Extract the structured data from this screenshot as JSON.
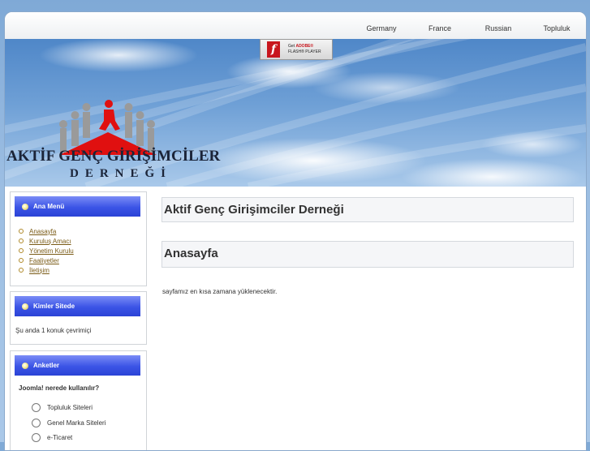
{
  "topnav": {
    "items": [
      {
        "label": "Germany"
      },
      {
        "label": "France"
      },
      {
        "label": "Russian"
      },
      {
        "label": "Topluluk"
      }
    ]
  },
  "header": {
    "flash": {
      "get": "Get",
      "adobe": "ADOBE®",
      "product": "FLASH® PLAYER"
    },
    "logo_title": "AKTİF GENÇ GİRİŞİMCİLER",
    "logo_sub": "DERNEĞİ",
    "colors": {
      "figure_accent": "#e01010",
      "figure_grey": "#9a9a9a"
    }
  },
  "sidebar": {
    "main_menu": {
      "title": "Ana Menü",
      "items": [
        {
          "label": "Anasayfa"
        },
        {
          "label": "Kuruluş Amacı"
        },
        {
          "label": "Yönetim Kurulu"
        },
        {
          "label": "Faaliyetler"
        },
        {
          "label": "İletişim"
        }
      ]
    },
    "who_online": {
      "title": "Kimler Sitede",
      "text": "Şu anda 1 konuk çevrimiçi"
    },
    "polls": {
      "title": "Anketler",
      "question": "Joomla! nerede kullanılır?",
      "options": [
        {
          "label": "Topluluk Siteleri"
        },
        {
          "label": "Genel Marka Siteleri"
        },
        {
          "label": "e-Ticaret"
        }
      ]
    }
  },
  "main": {
    "site_title": "Aktif Genç Girişimciler Derneği",
    "page_title": "Anasayfa",
    "message": "sayfamız en kısa zamana yüklenecektir."
  },
  "colors": {
    "module_header": "#3b54e6",
    "link": "#7a5b16",
    "background": "#9bbde2"
  }
}
